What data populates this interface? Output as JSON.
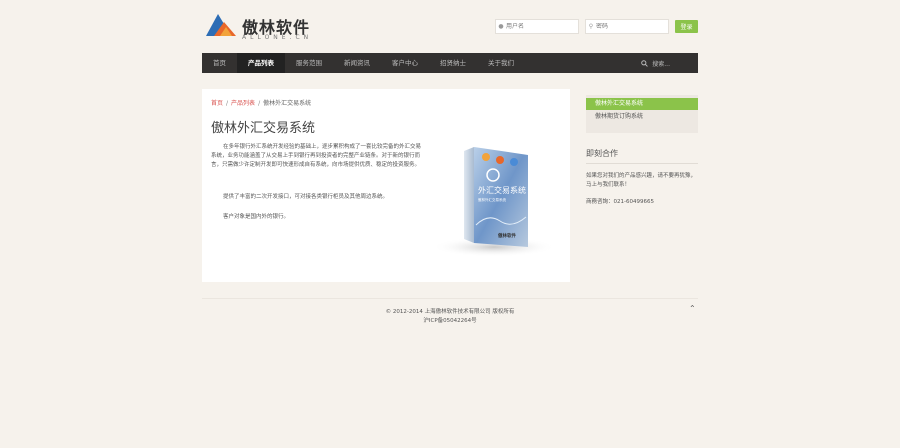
{
  "logo": {
    "name": "傲林软件",
    "sub": "ALLONE.CN"
  },
  "login": {
    "username_placeholder": "用户名",
    "password_placeholder": "密码",
    "button": "登录"
  },
  "nav": {
    "items": [
      "首页",
      "产品列表",
      "服务范围",
      "新闻资讯",
      "客户中心",
      "招贤纳士",
      "关于我们"
    ],
    "active_index": 1,
    "search_label": "搜索..."
  },
  "breadcrumb": {
    "home": "首页",
    "sep": "/",
    "category": "产品列表",
    "current": "傲林外汇交易系统"
  },
  "article": {
    "title": "傲林外汇交易系统",
    "p1": "在多年银行外汇系统开发经验的基础上，逐步累积构成了一套比较完备的外汇交易系统，业务功能涵盖了从交易上手到银行再到投资者的完整产业链条。对于新的银行而言，只需做少许定制开发即可快速形成自有系统，向市场提供优质、稳定的投资服务。",
    "p2": "提供了丰富的二次开发接口，可对接各类银行柜员及其他周边系统。",
    "p3": "客户对象是国内外的银行。"
  },
  "product_box": {
    "title": "外汇交易系统",
    "subtitle": "傲林外汇交易系统",
    "brand": "傲林软件"
  },
  "sidebar": {
    "items": [
      "傲林外汇交易系统",
      "傲林期货订购系统"
    ],
    "active_index": 0,
    "contact_heading": "即刻合作",
    "contact_text": "如果您对我们的产品感兴趣，请不要再犹豫，马上与我们联系！",
    "phone": "商務咨詢：021-60499665"
  },
  "footer": {
    "copyright": "© 2012-2014 上海傲林软件技术有限公司 版权所有",
    "icp": "沪ICP备05042264号"
  },
  "colors": {
    "accent": "#8bc34a",
    "nav_bg": "#333130",
    "page_bg": "#f6f2ec",
    "link": "#d9534f"
  }
}
